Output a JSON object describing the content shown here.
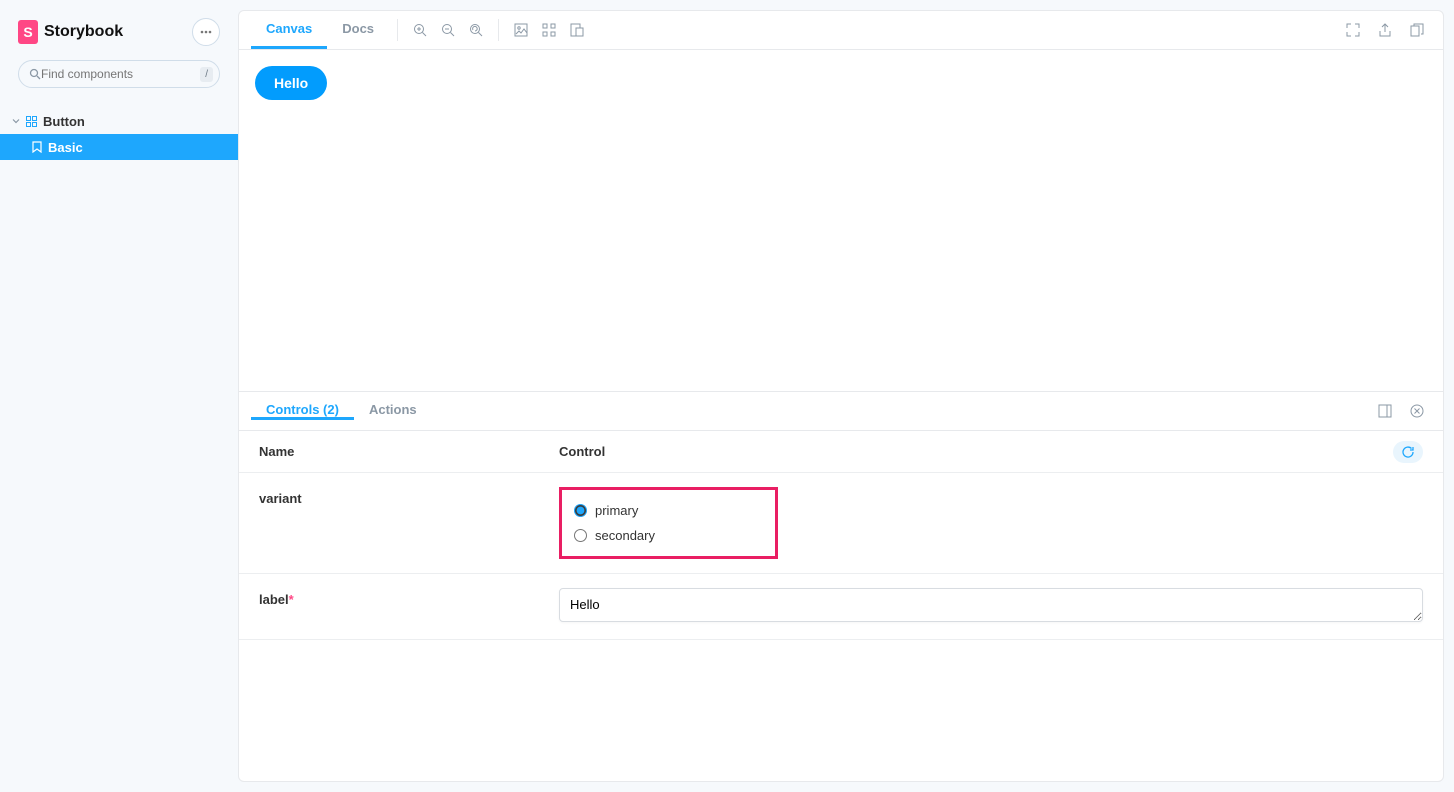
{
  "brand": {
    "name": "Storybook"
  },
  "search": {
    "placeholder": "Find components",
    "shortcut": "/"
  },
  "tree": {
    "component": "Button",
    "story": "Basic"
  },
  "topbar": {
    "tabs": {
      "canvas": "Canvas",
      "docs": "Docs"
    }
  },
  "preview": {
    "button_label": "Hello"
  },
  "addons": {
    "tabs": {
      "controls": "Controls (2)",
      "actions": "Actions"
    },
    "headers": {
      "name": "Name",
      "control": "Control"
    },
    "rows": {
      "variant": {
        "name": "variant",
        "options": {
          "primary": "primary",
          "secondary": "secondary"
        },
        "selected": "primary"
      },
      "label": {
        "name": "label",
        "required_marker": "*",
        "value": "Hello"
      }
    }
  }
}
